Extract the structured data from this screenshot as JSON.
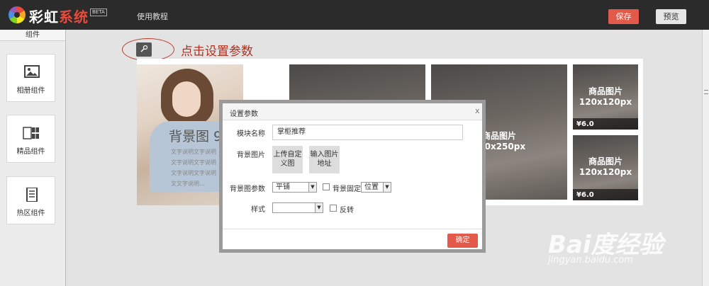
{
  "app": {
    "logo_text_main": "彩虹",
    "logo_text_accent": "系统",
    "beta": "BETA",
    "nav_tutorial": "使用教程",
    "save_label": "保存",
    "preview_label": "预览"
  },
  "sidebar": {
    "header": "组件",
    "items": [
      {
        "label": "相册组件",
        "icon": "photo-icon"
      },
      {
        "label": "精品组件",
        "icon": "grid-icon"
      },
      {
        "label": "热区组件",
        "icon": "document-icon"
      }
    ]
  },
  "canvas": {
    "callout": "点击设置参数",
    "bg_title": "背景图 9",
    "bg_desc": "文字说明文字说明文字说明文字说明文字说明文字说明文文字说明...",
    "tiles": [
      {
        "caption_line1": "",
        "caption_line2": ""
      },
      {
        "caption_line1": "商品图片",
        "caption_line2": "250x250px"
      },
      {
        "caption_line1": "商品图片",
        "caption_line2": "120x120px",
        "price": "¥6.0"
      },
      {
        "caption_line1": "商品图片",
        "caption_line2": "120x120px",
        "price": "¥6.0"
      }
    ]
  },
  "dialog": {
    "title": "设置参数",
    "close": "x",
    "name_label": "模块名称",
    "name_value": "掌柜推荐",
    "bg_label": "背景图片",
    "upload_btn": "上传自定义图",
    "url_btn": "输入图片地址",
    "bg_params_label": "背景图参数",
    "tile_select": "平铺",
    "fixed_label": "背景固定",
    "position_select": "位置",
    "style_label": "样式",
    "style_select": "",
    "flip_label": "反转",
    "ok_label": "确定"
  },
  "watermark": {
    "main": "Bai度经验",
    "sub": "jingyan.baidu.com"
  },
  "colors": {
    "accent": "#e45a4a",
    "topbar": "#2b2b2b",
    "callout": "#b03020"
  }
}
